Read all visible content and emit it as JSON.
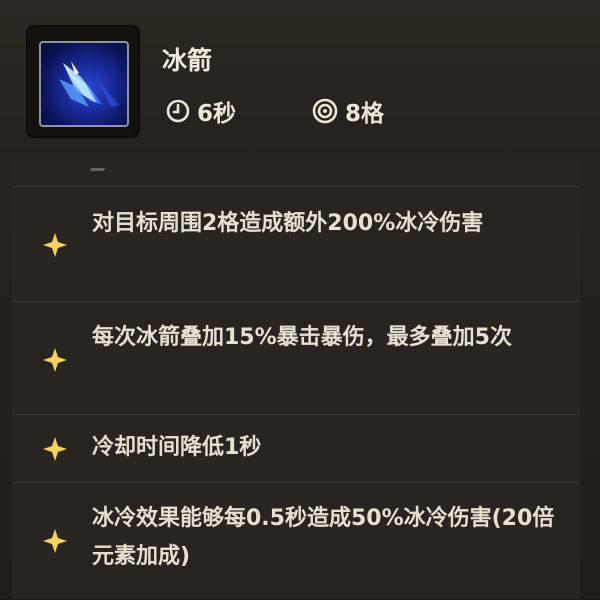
{
  "skill": {
    "name": "冰箭",
    "cooldown": "6秒",
    "range": "8格",
    "icon": "ice-arrow-icon"
  },
  "upgrades": [
    {
      "text": "对目标周围2格造成额外200%冰冷伤害"
    },
    {
      "text": "每次冰箭叠加15%暴击暴伤，最多叠加5次"
    },
    {
      "text": "冷却时间降低1秒"
    },
    {
      "text": "冰冷效果能够每0.5秒造成50%冰冷伤害(20倍元素加成)"
    }
  ],
  "colors": {
    "panel": "#2a2420",
    "star": "#f5d25a",
    "text": "#e9dfd1"
  }
}
